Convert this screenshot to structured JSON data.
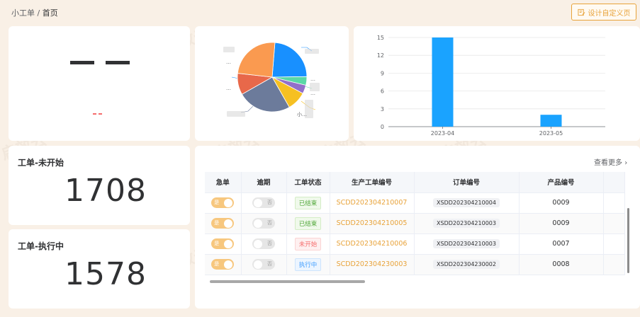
{
  "breadcrumb": {
    "parent": "小工单",
    "separator": "/",
    "current": "首页"
  },
  "design_button": {
    "label": "设计自定义页"
  },
  "pie_chart": {
    "labels": [
      "…",
      "…",
      "…",
      "…",
      "小…"
    ],
    "colors": [
      "#1890ff",
      "#5ad8a6",
      "#9270ca",
      "#f6c022",
      "#6c7b9b",
      "#e8684a",
      "#fa9a50"
    ]
  },
  "chart_data": {
    "type": "bar",
    "categories": [
      "2023-04",
      "2023-05"
    ],
    "values": [
      15,
      2
    ],
    "ylim": [
      0,
      15
    ],
    "yticks": [
      "0",
      "3",
      "6",
      "9",
      "12",
      "15"
    ],
    "color": "#1aa3ff",
    "grid": true
  },
  "kpi": [
    {
      "label": "工单-未开始",
      "value": "1708"
    },
    {
      "label": "工单-执行中",
      "value": "1578"
    }
  ],
  "table": {
    "more_link": "查看更多",
    "columns": [
      "急单",
      "逾期",
      "工单状态",
      "生产工单编号",
      "订单编号",
      "产品编号"
    ],
    "rows": [
      {
        "urgent": "是",
        "overdue": "否",
        "status": "已结束",
        "status_type": "done",
        "work_order": "SCDD202304210007",
        "order": "XSDD202304210004",
        "product": "0009"
      },
      {
        "urgent": "是",
        "overdue": "否",
        "status": "已结束",
        "status_type": "done",
        "work_order": "SCDD202304210005",
        "order": "XSDD202304210003",
        "product": "0009"
      },
      {
        "urgent": "是",
        "overdue": "否",
        "status": "未开始",
        "status_type": "todo",
        "work_order": "SCDD202304210006",
        "order": "XSDD202304210003",
        "product": "0007"
      },
      {
        "urgent": "是",
        "overdue": "否",
        "status": "执行中",
        "status_type": "doing",
        "work_order": "SCDD202304230003",
        "order": "XSDD202304230002",
        "product": "0008"
      }
    ]
  },
  "watermark": "启效云"
}
